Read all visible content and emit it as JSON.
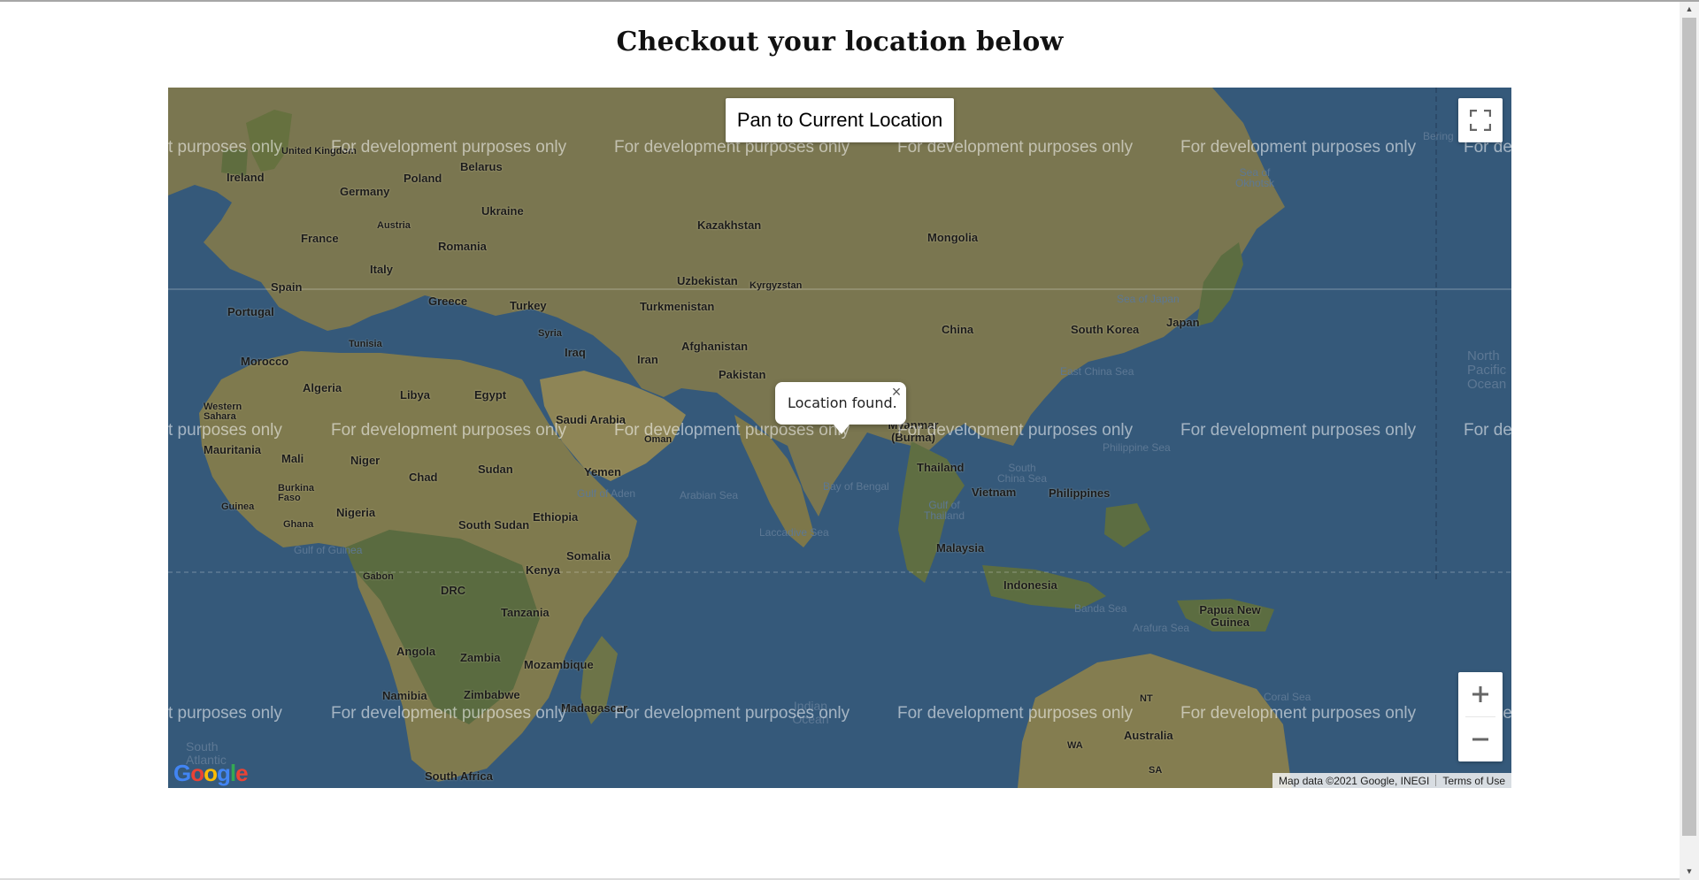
{
  "page": {
    "title": "Checkout your location below"
  },
  "map": {
    "pan_button_label": "Pan to Current Location",
    "info_window": {
      "text": "Location found.",
      "close_glyph": "×"
    },
    "zoom_in_glyph": "+",
    "zoom_out_glyph": "−",
    "fullscreen_icon": "fullscreen-icon",
    "watermark": {
      "full": "For development purposes only",
      "left_clip": "t purposes only",
      "right_clip": "For de"
    },
    "attribution": {
      "data": "Map data ©2021 Google, INEGI",
      "terms": "Terms of Use"
    },
    "logo_text": "Google",
    "colors": {
      "ocean": "#35597a",
      "land": "#7f7a4e",
      "forest": "#596b41",
      "desert": "#8e8556"
    },
    "labels": [
      {
        "text": "United Kingdom"
      },
      {
        "text": "Ireland"
      },
      {
        "text": "Belarus"
      },
      {
        "text": "Poland"
      },
      {
        "text": "Germany"
      },
      {
        "text": "Austria"
      },
      {
        "text": "Ukraine"
      },
      {
        "text": "France"
      },
      {
        "text": "Romania"
      },
      {
        "text": "Kazakhstan"
      },
      {
        "text": "Mongolia"
      },
      {
        "text": "Italy"
      },
      {
        "text": "Spain"
      },
      {
        "text": "Portugal"
      },
      {
        "text": "Greece"
      },
      {
        "text": "Turkey"
      },
      {
        "text": "Uzbekistan"
      },
      {
        "text": "Kyrgyzstan"
      },
      {
        "text": "Turkmenistan"
      },
      {
        "text": "China"
      },
      {
        "text": "South Korea"
      },
      {
        "text": "Japan"
      },
      {
        "text": "Syria"
      },
      {
        "text": "Tunisia"
      },
      {
        "text": "Iraq"
      },
      {
        "text": "Iran"
      },
      {
        "text": "Afghanistan"
      },
      {
        "text": "Morocco"
      },
      {
        "text": "Pakistan"
      },
      {
        "text": "Algeria"
      },
      {
        "text": "Libya"
      },
      {
        "text": "Egypt"
      },
      {
        "text": "Western Sahara"
      },
      {
        "text": "Saudi Arabia"
      },
      {
        "text": "Oman"
      },
      {
        "text": "Myanmar (Burma)"
      },
      {
        "text": "Mauritania"
      },
      {
        "text": "Mali"
      },
      {
        "text": "Niger"
      },
      {
        "text": "Sudan"
      },
      {
        "text": "Yemen"
      },
      {
        "text": "Thailand"
      },
      {
        "text": "Chad"
      },
      {
        "text": "Burkina Faso"
      },
      {
        "text": "Vietnam"
      },
      {
        "text": "Philippines"
      },
      {
        "text": "Guinea"
      },
      {
        "text": "Nigeria"
      },
      {
        "text": "Ethiopia"
      },
      {
        "text": "Ghana"
      },
      {
        "text": "South Sudan"
      },
      {
        "text": "Malaysia"
      },
      {
        "text": "Somalia"
      },
      {
        "text": "Kenya"
      },
      {
        "text": "Gabon"
      },
      {
        "text": "DRC"
      },
      {
        "text": "Indonesia"
      },
      {
        "text": "Tanzania"
      },
      {
        "text": "Papua New Guinea"
      },
      {
        "text": "Angola"
      },
      {
        "text": "Zambia"
      },
      {
        "text": "Mozambique"
      },
      {
        "text": "Namibia"
      },
      {
        "text": "Zimbabwe"
      },
      {
        "text": "Madagascar"
      },
      {
        "text": "Australia"
      },
      {
        "text": "South Africa"
      },
      {
        "text": "NT"
      },
      {
        "text": "WA"
      },
      {
        "text": "SA"
      },
      {
        "text": "South Atlantic"
      },
      {
        "text": "Indian Ocean"
      }
    ],
    "seas": [
      {
        "text": "Sea of Okhotsk"
      },
      {
        "text": "Sea of Japan"
      },
      {
        "text": "East China Sea"
      },
      {
        "text": "Philippine Sea"
      },
      {
        "text": "North Pacific Ocean"
      },
      {
        "text": "South China Sea"
      },
      {
        "text": "Gulf of Thailand"
      },
      {
        "text": "Bay of Bengal"
      },
      {
        "text": "Arabian Sea"
      },
      {
        "text": "Gulf of Aden"
      },
      {
        "text": "Laccadive Sea"
      },
      {
        "text": "Gulf of Guinea"
      },
      {
        "text": "Banda Sea"
      },
      {
        "text": "Arafura Sea"
      },
      {
        "text": "Coral Sea"
      },
      {
        "text": "Bering"
      }
    ]
  }
}
